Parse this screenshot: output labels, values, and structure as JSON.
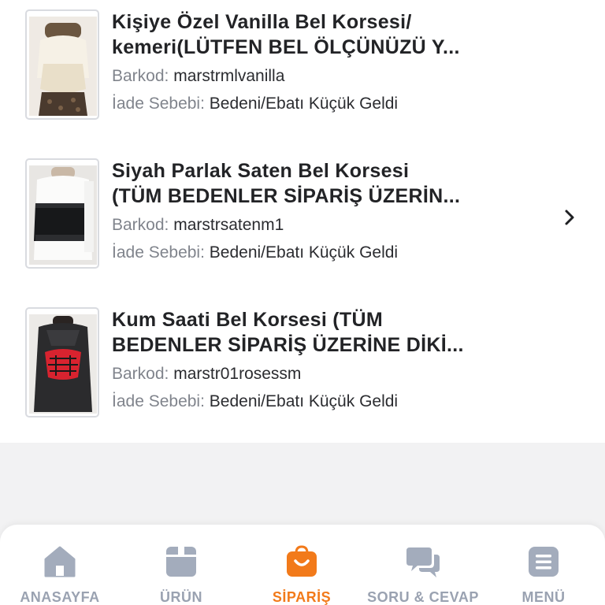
{
  "colors": {
    "accent": "#f27a1a",
    "tab_inactive": "#9aa2b1",
    "muted_text": "#80848c"
  },
  "items": [
    {
      "title_line1": "Kişiye Özel Vanilla Bel Korsesi/",
      "title_line2": "kemeri(LÜTFEN BEL ÖLÇÜNÜZÜ Y...",
      "barcode_label": "Barkod:",
      "barcode": "marstrmlvanilla",
      "reason_label": "İade Sebebi:",
      "reason": "Bedeni/Ebatı Küçük Geldi"
    },
    {
      "title_line1": "Siyah Parlak Saten Bel Korsesi",
      "title_line2": "(TÜM BEDENLER SİPARİŞ ÜZERİN...",
      "barcode_label": "Barkod:",
      "barcode": "marstrsatenm1",
      "reason_label": "İade Sebebi:",
      "reason": "Bedeni/Ebatı Küçük Geldi"
    },
    {
      "title_line1": "Kum Saati Bel Korsesi (TÜM",
      "title_line2": "BEDENLER SİPARİŞ ÜZERİNE DİKİ...",
      "barcode_label": "Barkod:",
      "barcode": "marstr01rosessm",
      "reason_label": "İade Sebebi:",
      "reason": "Bedeni/Ebatı Küçük Geldi"
    }
  ],
  "chevron_icon": "chevron-right-icon",
  "tabbar": {
    "tabs": [
      {
        "label": "ANASAYFA",
        "icon": "home-icon",
        "active": false
      },
      {
        "label": "ÜRÜN",
        "icon": "box-icon",
        "active": false
      },
      {
        "label": "SİPARİŞ",
        "icon": "shopping-bag-icon",
        "active": true
      },
      {
        "label": "SORU & CEVAP",
        "icon": "chat-bubbles-icon",
        "active": false
      },
      {
        "label": "MENÜ",
        "icon": "menu-icon",
        "active": false
      }
    ]
  }
}
